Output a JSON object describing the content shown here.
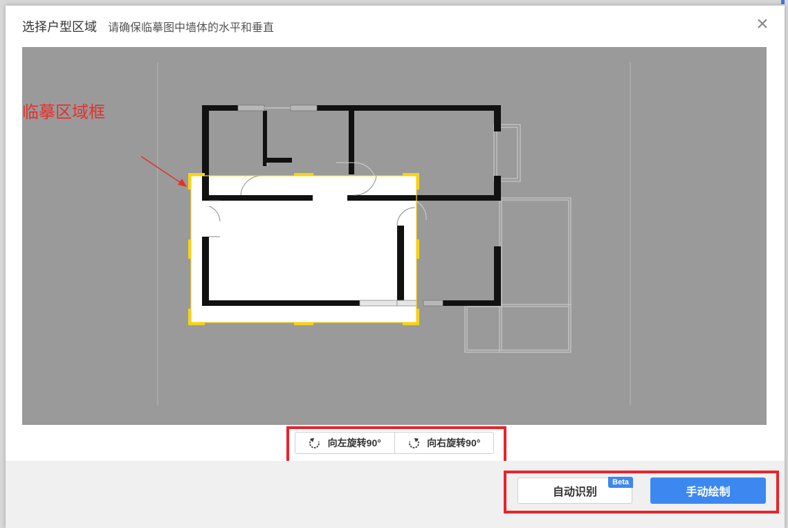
{
  "dialog": {
    "title": "选择户型区域",
    "subtitle": "请确保临摹图中墙体的水平和垂直",
    "close_icon": "×"
  },
  "canvas": {
    "annotation_label": "临摹区域框"
  },
  "rotate": {
    "left_label": "向左旋转90°",
    "right_label": "向右旋转90°",
    "left_icon": "rotate-left-icon",
    "right_icon": "rotate-right-icon"
  },
  "actions": {
    "auto_label": "自动识别",
    "beta_badge": "Beta",
    "manual_label": "手动绘制"
  },
  "colors": {
    "primary": "#3d87f0",
    "highlight": "#e8232a",
    "selection": "#f5d21b",
    "annotation": "#e5302c"
  }
}
